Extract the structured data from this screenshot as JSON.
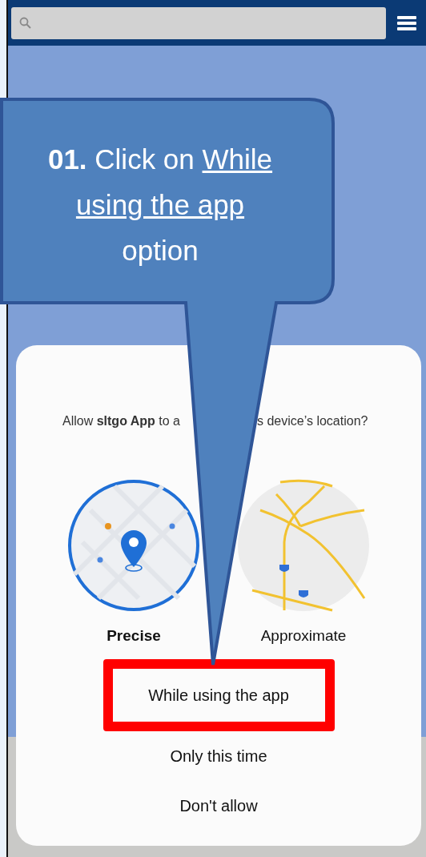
{
  "callout": {
    "text_before": "**01.** Click on",
    "underlined": "While using the app",
    "text_after": "option"
  },
  "dialog": {
    "prompt_left": "Allow **sltgo App** to a",
    "prompt_right": "s device’s location?",
    "accuracy": [
      {
        "kind": "precise",
        "label": "Precise",
        "selected": true
      },
      {
        "kind": "approximate",
        "label": "Approximate",
        "selected": false
      }
    ],
    "options": [
      {
        "label": "While using the app",
        "highlighted": true
      },
      {
        "label": "Only this time",
        "highlighted": false
      },
      {
        "label": "Don't allow",
        "highlighted": false
      }
    ]
  }
}
